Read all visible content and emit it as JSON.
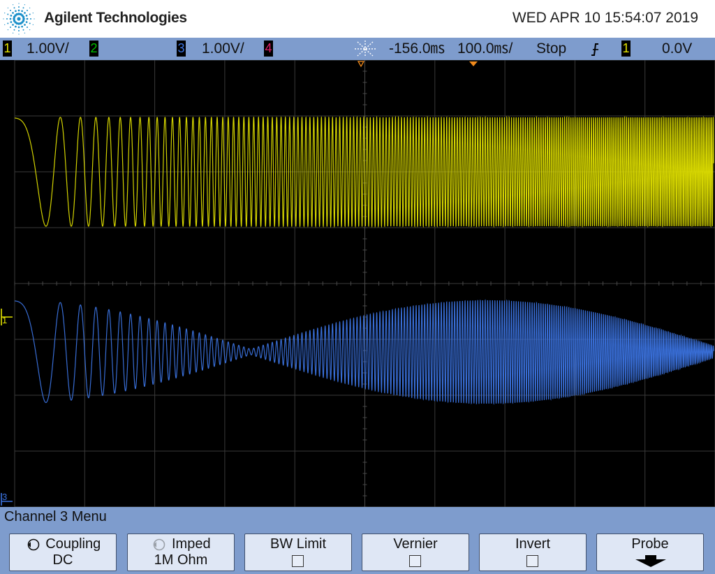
{
  "header": {
    "brand": "Agilent Technologies",
    "datetime": "WED APR 10 15:54:07 2019"
  },
  "status": {
    "ch1_num": "1",
    "ch1_scale": "1.00V/",
    "ch2_num": "2",
    "ch3_num": "3",
    "ch3_scale": "1.00V/",
    "ch4_num": "4",
    "time_delay": "-156.0㎳",
    "time_scale": "100.0㎳/",
    "run_state": "Stop",
    "trigger_source": "1",
    "trigger_level": "0.0V"
  },
  "markers": {
    "ch1": "1",
    "ch3": "3"
  },
  "colors": {
    "ch1": "#e6e600",
    "ch2": "#00c000",
    "ch3": "#3b73e0",
    "ch4": "#e0206a",
    "trigger": "#f08a1c"
  },
  "menu": {
    "title": "Channel 3  Menu"
  },
  "softkeys": [
    {
      "label": "Coupling",
      "value": "DC"
    },
    {
      "label": "Imped",
      "value": "1M Ohm"
    },
    {
      "label": "BW Limit"
    },
    {
      "label": "Vernier"
    },
    {
      "label": "Invert"
    },
    {
      "label": "Probe"
    }
  ]
}
